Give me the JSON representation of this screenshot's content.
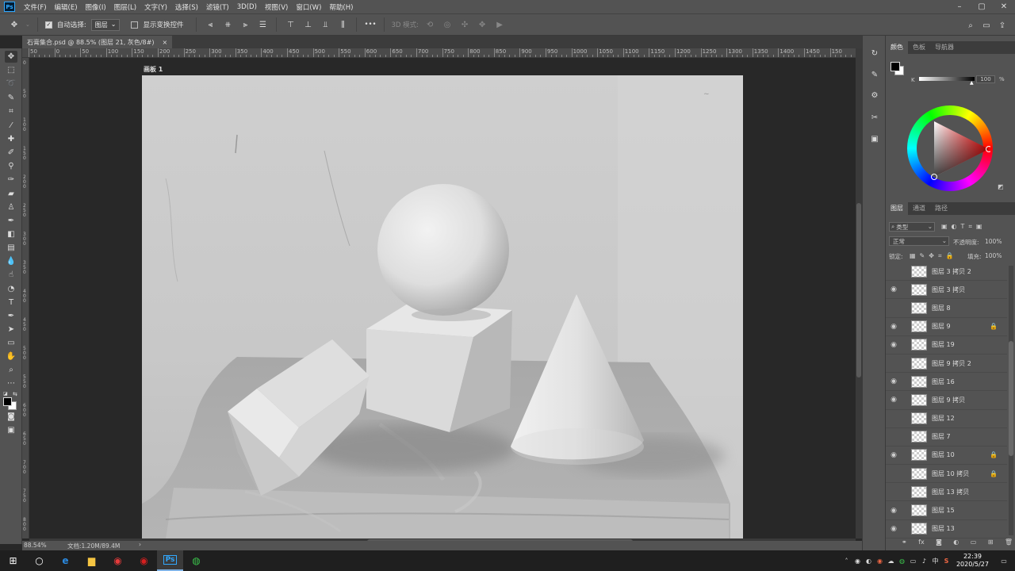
{
  "app": {
    "logo": "Ps"
  },
  "menu": [
    "文件(F)",
    "编辑(E)",
    "图像(I)",
    "图层(L)",
    "文字(Y)",
    "选择(S)",
    "滤镜(T)",
    "3D(D)",
    "视图(V)",
    "窗口(W)",
    "帮助(H)"
  ],
  "window_controls": [
    "–",
    "▢",
    "✕"
  ],
  "options": {
    "auto_select_label": "自动选择:",
    "auto_select_checked": true,
    "auto_select_target": "图层",
    "show_transform_label": "显示变换控件",
    "mode_3d_label": "3D 模式:",
    "more": "•••"
  },
  "document_tab": {
    "title": "石膏集合.psd @ 88.5% (图层 21, 灰色/8#)",
    "close": "×"
  },
  "artboard_label": "画板 1",
  "ruler": {
    "h_labels": [
      "50",
      "0",
      "50",
      "100",
      "150",
      "200",
      "250",
      "300",
      "350",
      "400",
      "450",
      "500",
      "550",
      "600",
      "650",
      "700",
      "750",
      "800",
      "850",
      "900",
      "950",
      "1000",
      "1050",
      "1100",
      "1150",
      "1200",
      "1250",
      "1300",
      "1350",
      "1400",
      "1450",
      "150"
    ],
    "v_labels": [
      "0",
      "50",
      "100",
      "150",
      "200",
      "250",
      "300",
      "350",
      "400",
      "450",
      "500",
      "550",
      "600",
      "650",
      "700",
      "750",
      "800"
    ]
  },
  "status": {
    "zoom": "88.54%",
    "doc": "文档:1.20M/89.4M",
    "arrow": "›"
  },
  "color_panel": {
    "tabs": [
      "颜色",
      "色板",
      "导航器"
    ],
    "k_label": "K",
    "k_value": "100",
    "percent": "%",
    "foreground": "#000000",
    "background": "#ffffff"
  },
  "layers_panel": {
    "tabs": [
      "图层",
      "通道",
      "路径"
    ],
    "filter_label": "类型",
    "blend_mode": "正常",
    "opacity_label": "不透明度:",
    "opacity_value": "100%",
    "lock_label": "锁定:",
    "fill_label": "填充:",
    "fill_value": "100%",
    "layers": [
      {
        "name": "图层 3 拷贝 2",
        "visible": false,
        "locked": false
      },
      {
        "name": "图层 3 拷贝",
        "visible": true,
        "locked": false
      },
      {
        "name": "图层 8",
        "visible": false,
        "locked": false
      },
      {
        "name": "图层 9",
        "visible": true,
        "locked": true
      },
      {
        "name": "图层 19",
        "visible": true,
        "locked": false
      },
      {
        "name": "图层 9 拷贝 2",
        "visible": false,
        "locked": false
      },
      {
        "name": "图层 16",
        "visible": true,
        "locked": false
      },
      {
        "name": "图层 9 拷贝",
        "visible": true,
        "locked": false
      },
      {
        "name": "图层 12",
        "visible": false,
        "locked": false
      },
      {
        "name": "图层 7",
        "visible": false,
        "locked": false
      },
      {
        "name": "图层 10",
        "visible": true,
        "locked": true
      },
      {
        "name": "图层 10 拷贝",
        "visible": false,
        "locked": true
      },
      {
        "name": "图层 13 拷贝",
        "visible": false,
        "locked": false
      },
      {
        "name": "图层 15",
        "visible": true,
        "locked": false
      },
      {
        "name": "图层 13",
        "visible": true,
        "locked": false
      }
    ]
  },
  "taskbar": {
    "time": "22:39",
    "date": "2020/5/27",
    "ime": "中",
    "apps": [
      "windows-start",
      "cortana-search",
      "browser",
      "file-explorer",
      "netease-music",
      "netease-cloud",
      "photoshop",
      "wechat"
    ]
  }
}
